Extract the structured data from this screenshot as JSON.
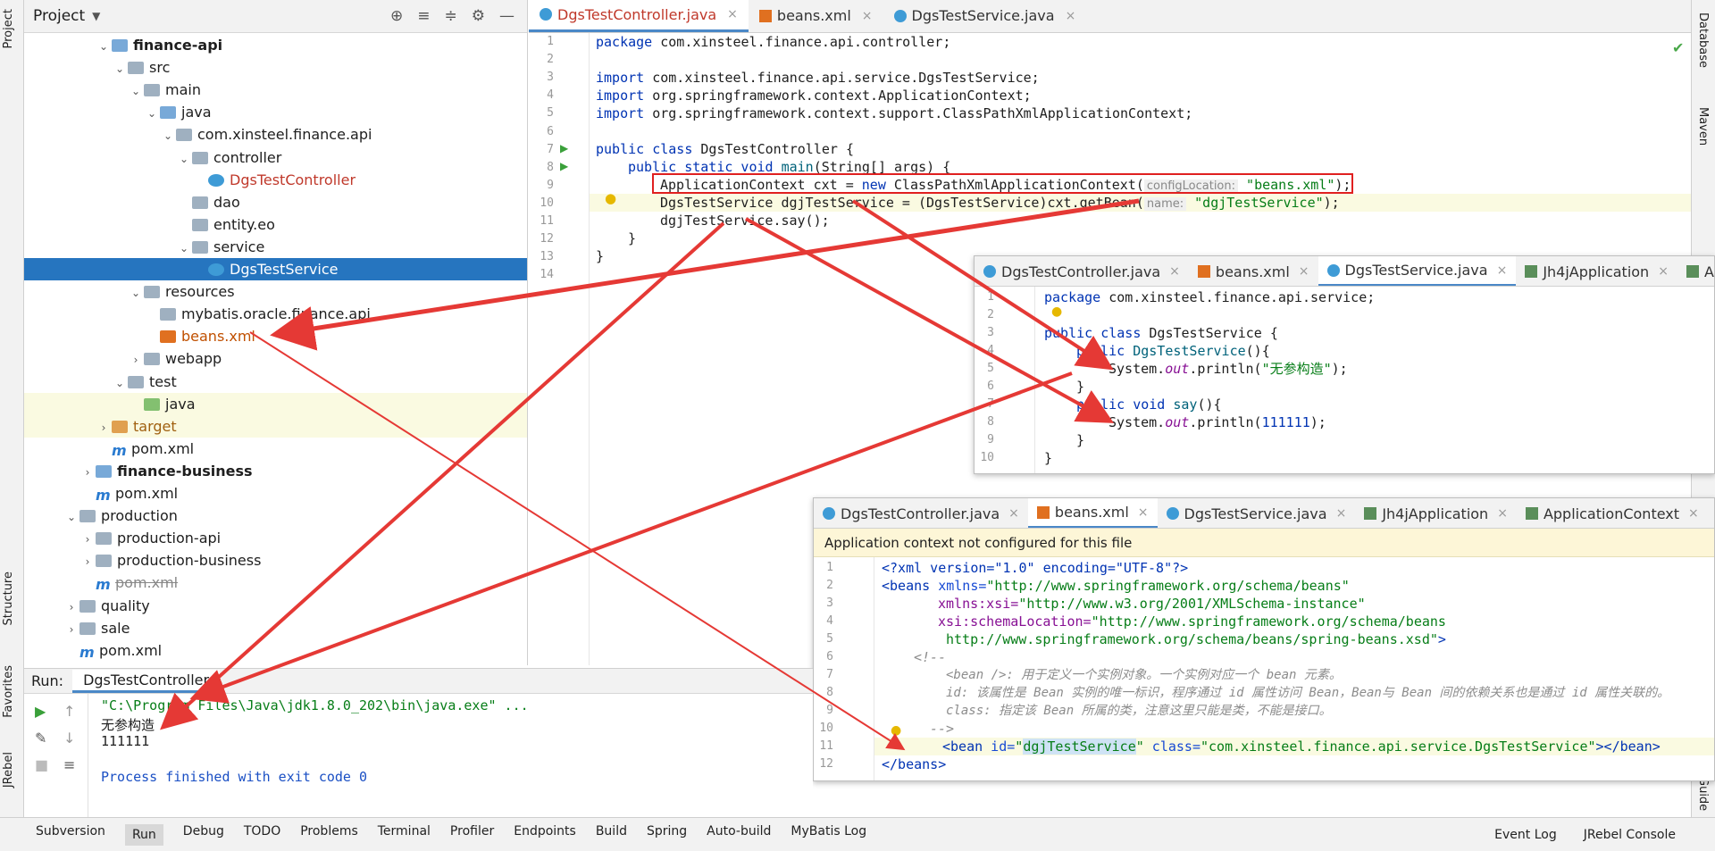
{
  "left_strip": {
    "project": "Project",
    "structure": "Structure",
    "favorites": "Favorites",
    "jrebel": "JRebel"
  },
  "right_strip": {
    "database": "Database",
    "maven": "Maven",
    "guide": "Guide"
  },
  "project": {
    "title": "Project",
    "tree": [
      {
        "label": "finance-api",
        "icon": "module",
        "bold": true,
        "chev": "v"
      },
      {
        "label": "src",
        "icon": "folder",
        "chev": "v"
      },
      {
        "label": "main",
        "icon": "folder",
        "chev": "v"
      },
      {
        "label": "java",
        "icon": "source-folder",
        "chev": "v"
      },
      {
        "label": "com.xinsteel.finance.api",
        "icon": "package",
        "chev": "v"
      },
      {
        "label": "controller",
        "icon": "package",
        "chev": "v"
      },
      {
        "label": "DgsTestController",
        "icon": "class",
        "chev": ""
      },
      {
        "label": "dao",
        "icon": "package",
        "chev": ""
      },
      {
        "label": "entity.eo",
        "icon": "package",
        "chev": ""
      },
      {
        "label": "service",
        "icon": "package",
        "chev": "v"
      },
      {
        "label": "DgsTestService",
        "icon": "class",
        "chev": "",
        "selected": true
      },
      {
        "label": "resources",
        "icon": "resources-folder",
        "chev": "v"
      },
      {
        "label": "mybatis.oracle.finance.api",
        "icon": "package",
        "chev": ""
      },
      {
        "label": "beans.xml",
        "icon": "xml",
        "chev": ""
      },
      {
        "label": "webapp",
        "icon": "folder",
        "chev": ">"
      },
      {
        "label": "test",
        "icon": "folder",
        "chev": "v"
      },
      {
        "label": "java",
        "icon": "test-folder",
        "chev": ""
      },
      {
        "label": "target",
        "icon": "excluded-folder",
        "chev": ">"
      },
      {
        "label": "pom.xml",
        "icon": "maven",
        "chev": ""
      },
      {
        "label": "finance-business",
        "icon": "module",
        "bold": true,
        "chev": ">"
      },
      {
        "label": "pom.xml",
        "icon": "maven",
        "chev": ""
      },
      {
        "label": "production",
        "icon": "folder",
        "chev": "v"
      },
      {
        "label": "production-api",
        "icon": "folder",
        "chev": ">"
      },
      {
        "label": "production-business",
        "icon": "folder",
        "chev": ">"
      },
      {
        "label": "pom.xml",
        "icon": "maven",
        "chev": "",
        "strike": true
      },
      {
        "label": "quality",
        "icon": "folder",
        "chev": ">"
      },
      {
        "label": "sale",
        "icon": "folder",
        "chev": ">"
      },
      {
        "label": "pom.xml",
        "icon": "maven",
        "chev": ""
      }
    ]
  },
  "editor": {
    "tabs": [
      {
        "label": "DgsTestController.java",
        "active": true,
        "kind": "class"
      },
      {
        "label": "beans.xml",
        "active": false,
        "kind": "xml"
      },
      {
        "label": "DgsTestService.java",
        "active": false,
        "kind": "class"
      }
    ],
    "line_numbers": [
      "1",
      "2",
      "3",
      "4",
      "5",
      "6",
      "7",
      "8",
      "9",
      "10",
      "11",
      "12",
      "13",
      "14"
    ],
    "code": {
      "l1_kw": "package",
      "l1_rest": " com.xinsteel.finance.api.controller;",
      "l3_kw": "import",
      "l3_rest": " com.xinsteel.finance.api.service.DgsTestService;",
      "l4_kw": "import",
      "l4_rest": " org.springframework.context.ApplicationContext;",
      "l5_kw": "import",
      "l5_rest": " org.springframework.context.support.ClassPathXmlApplicationContext;",
      "l7_kw": "public class",
      "l7_rest": " DgsTestController {",
      "l8_kw": "public static void",
      "l8_fn": "main",
      "l8_rest": "(String[] args) {",
      "l9_a": "ApplicationContext cxt = ",
      "l9_kw": "new",
      "l9_b": " ClassPathXmlApplicationContext(",
      "l9_hint": "configLocation:",
      "l9_str": "\"beans.xml\"",
      "l9_end": ");",
      "l10_a": "DgsTestService ",
      "l10_var": "dgjTestService",
      "l10_b": " = (DgsTestService)cxt.getBean(",
      "l10_hint": "name:",
      "l10_str": "\"dgjTestService\"",
      "l10_end": ");",
      "l11_var": "dgjTestService",
      "l11_rest": ".say();",
      "l12": "}",
      "l13": "}"
    }
  },
  "popup_service": {
    "tabs": [
      {
        "label": "DgsTestController.java",
        "active": false
      },
      {
        "label": "beans.xml",
        "active": false
      },
      {
        "label": "DgsTestService.java",
        "active": true
      },
      {
        "label": "Jh4jApplication",
        "active": false
      },
      {
        "label": "Applic",
        "active": false
      }
    ],
    "line_numbers": [
      "1",
      "2",
      "3",
      "4",
      "5",
      "6",
      "7",
      "8",
      "9",
      "10"
    ],
    "code": {
      "l1_kw": "package",
      "l1_rest": " com.xinsteel.finance.api.service;",
      "l3_kw": "public class",
      "l3_rest": " DgsTestService {",
      "l4_kw": "public",
      "l4_fn": "DgsTestService",
      "l4_rest": "(){",
      "l5_a": "System.",
      "l5_it": "out",
      "l5_b": ".println(",
      "l5_str": "\"无参构造\"",
      "l5_end": ");",
      "l6": "}",
      "l7_kw": "public void",
      "l7_fn": "say",
      "l7_rest": "(){",
      "l8_a": "System.",
      "l8_it": "out",
      "l8_b": ".println(",
      "l8_num": "111111",
      "l8_end": ");",
      "l9": "}",
      "l10": "}"
    }
  },
  "popup_beans": {
    "tabs": [
      {
        "label": "DgsTestController.java",
        "active": false
      },
      {
        "label": "beans.xml",
        "active": true
      },
      {
        "label": "DgsTestService.java",
        "active": false
      },
      {
        "label": "Jh4jApplication",
        "active": false
      },
      {
        "label": "ApplicationContext",
        "active": false
      }
    ],
    "banner": "Application context not configured for this file",
    "line_numbers": [
      "1",
      "2",
      "3",
      "4",
      "5",
      "6",
      "7",
      "8",
      "9",
      "10",
      "11",
      "12"
    ],
    "code": {
      "l1": "<?xml version=\"1.0\" encoding=\"UTF-8\"?>",
      "l2_tag": "<beans",
      "l2_attr": " xmlns=",
      "l2_str": "\"http://www.springframework.org/schema/beans\"",
      "l3_attr": "xmlns:xsi=",
      "l3_str": "\"http://www.w3.org/2001/XMLSchema-instance\"",
      "l4_attr": "xsi:schemaLocation=",
      "l4_str": "\"http://www.springframework.org/schema/beans",
      "l5_str": "http://www.springframework.org/schema/beans/spring-beans.xsd\"",
      "l5_end": ">",
      "l6": "<!--",
      "l7": "<bean />: 用于定义一个实例对象。一个实例对应一个 bean 元素。",
      "l8": "id: 该属性是 Bean 实例的唯一标识，程序通过 id 属性访问 Bean，Bean与 Bean 间的依赖关系也是通过 id 属性关联的。",
      "l9": "class: 指定该 Bean 所属的类，注意这里只能是类，不能是接口。",
      "l10": "-->",
      "l11_tag": "<bean",
      "l11_attr1": " id=",
      "l11_q1": "\"",
      "l11_id": "dgjTestService",
      "l11_q2": "\"",
      "l11_attr2": " class=",
      "l11_str": "\"com.xinsteel.finance.api.service.DgsTestService\"",
      "l11_end": "></bean>",
      "l12": "</beans>"
    }
  },
  "run": {
    "label": "Run:",
    "tab": "DgsTestController",
    "output": [
      "\"C:\\Program Files\\Java\\jdk1.8.0_202\\bin\\java.exe\" ...",
      "无参构造",
      "111111",
      "",
      "Process finished with exit code 0"
    ]
  },
  "statusbar": {
    "items": [
      "Subversion",
      "Run",
      "Debug",
      "TODO",
      "Problems",
      "Terminal",
      "Profiler",
      "Endpoints",
      "Build",
      "Spring",
      "Auto-build",
      "MyBatis Log"
    ],
    "active": "Run",
    "right": [
      "Event Log",
      "JRebel Console"
    ]
  },
  "colors": {
    "annotation_red": "#e53935",
    "selection": "#2675bf",
    "tab_accent": "#4a88c7"
  }
}
